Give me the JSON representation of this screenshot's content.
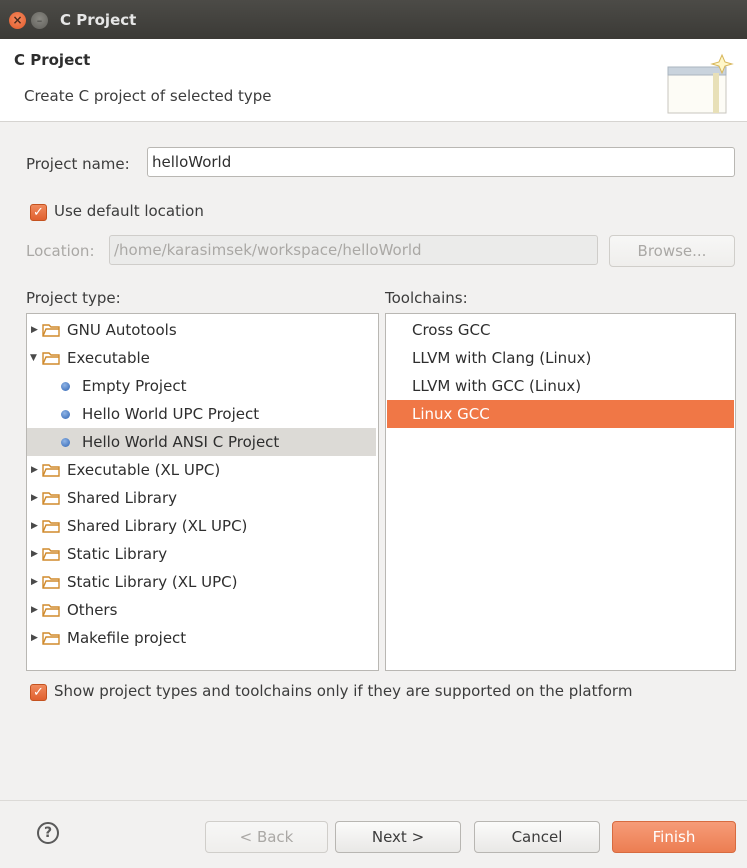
{
  "window": {
    "title": "C Project"
  },
  "header": {
    "title": "C Project",
    "subtitle": "Create C project of selected type"
  },
  "project_name": {
    "label": "Project name:",
    "value": "helloWorld"
  },
  "use_default_location": {
    "label": "Use default location",
    "checked": true
  },
  "location": {
    "label": "Location:",
    "value": "/home/karasimsek/workspace/helloWorld",
    "browse_label": "Browse..."
  },
  "project_type": {
    "label": "Project type:",
    "items": [
      {
        "label": "GNU Autotools",
        "kind": "folder",
        "expanded": false
      },
      {
        "label": "Executable",
        "kind": "folder",
        "expanded": true
      },
      {
        "label": "Empty Project",
        "kind": "leaf"
      },
      {
        "label": "Hello World UPC Project",
        "kind": "leaf"
      },
      {
        "label": "Hello World ANSI C Project",
        "kind": "leaf",
        "selected": true
      },
      {
        "label": "Executable (XL UPC)",
        "kind": "folder",
        "expanded": false
      },
      {
        "label": "Shared Library",
        "kind": "folder",
        "expanded": false
      },
      {
        "label": "Shared Library (XL UPC)",
        "kind": "folder",
        "expanded": false
      },
      {
        "label": "Static Library",
        "kind": "folder",
        "expanded": false
      },
      {
        "label": "Static Library (XL UPC)",
        "kind": "folder",
        "expanded": false
      },
      {
        "label": "Others",
        "kind": "folder",
        "expanded": false
      },
      {
        "label": "Makefile project",
        "kind": "folder",
        "expanded": false
      }
    ]
  },
  "toolchains": {
    "label": "Toolchains:",
    "items": [
      {
        "label": "Cross GCC"
      },
      {
        "label": "LLVM with Clang (Linux)"
      },
      {
        "label": "LLVM with GCC (Linux)"
      },
      {
        "label": "Linux GCC",
        "selected": true
      }
    ]
  },
  "show_supported": {
    "label": "Show project types and toolchains only if they are supported on the platform",
    "checked": true
  },
  "footer": {
    "help": "?",
    "back": "< Back",
    "next": "Next >",
    "cancel": "Cancel",
    "finish": "Finish"
  },
  "colors": {
    "accent": "#f07746",
    "selection": "#dcdad6",
    "titlebar": "#3c3b37"
  }
}
